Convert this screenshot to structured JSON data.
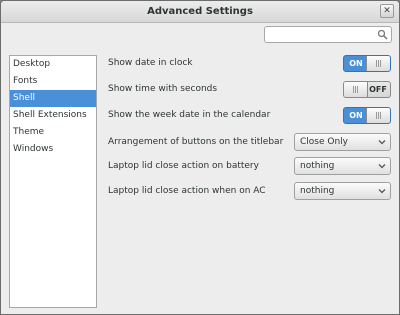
{
  "window": {
    "title": "Advanced Settings",
    "close_glyph": "✕"
  },
  "search": {
    "value": "",
    "placeholder": ""
  },
  "sidebar": {
    "items": [
      {
        "label": "Desktop",
        "selected": false
      },
      {
        "label": "Fonts",
        "selected": false
      },
      {
        "label": "Shell",
        "selected": true
      },
      {
        "label": "Shell Extensions",
        "selected": false
      },
      {
        "label": "Theme",
        "selected": false
      },
      {
        "label": "Windows",
        "selected": false
      }
    ]
  },
  "settings": {
    "show_date": {
      "label": "Show date in clock",
      "state": "ON"
    },
    "show_seconds": {
      "label": "Show time with seconds",
      "state": "OFF"
    },
    "show_week_date": {
      "label": "Show the week date in the calendar",
      "state": "ON"
    },
    "button_arrangement": {
      "label": "Arrangement of buttons on the titlebar",
      "value": "Close Only"
    },
    "lid_battery": {
      "label": "Laptop lid close action on battery",
      "value": "nothing"
    },
    "lid_ac": {
      "label": "Laptop lid close action when on AC",
      "value": "nothing"
    }
  },
  "colors": {
    "accent": "#4a90d9",
    "window_bg": "#ededed",
    "desktop_bg": "#7f7f7f"
  },
  "icons": {
    "search": "search-icon",
    "close": "close-icon",
    "dropdown": "chevron-down-icon"
  }
}
